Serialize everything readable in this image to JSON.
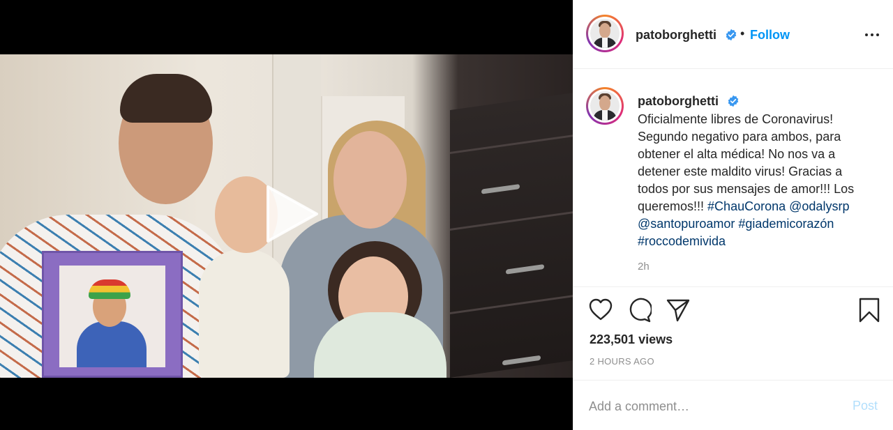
{
  "post": {
    "username": "patoborghetti",
    "verified": true,
    "header_separator": "•",
    "follow_label": "Follow",
    "caption": {
      "line1": "Oficialmente libres de Coronavirus!",
      "line2": "Segundo negativo para ambos, para",
      "line3": "obtener el alta médica! No nos va a",
      "line4": "detener este maldito virus! Gracias a",
      "line5": "todos por sus mensajes de amor!!! Los",
      "line6_text": "queremos!!! ",
      "tags": [
        "#ChauCorona",
        "@odalysrp",
        "@santopuroamor",
        "#giademicorazón",
        "#roccodemivida"
      ]
    },
    "caption_time": "2h",
    "views": "223,501 views",
    "time_ago": "2 HOURS AGO",
    "comment_placeholder": "Add a comment…",
    "post_label": "Post"
  },
  "icons": {
    "more": "more-options-icon",
    "verified": "verified-badge-icon",
    "like": "heart-icon",
    "comment": "comment-bubble-icon",
    "share": "paper-plane-icon",
    "save": "bookmark-icon",
    "play": "play-icon"
  },
  "colors": {
    "accent": "#0095f6",
    "tag": "#00376b",
    "muted": "#8e8e8e",
    "post_disabled": "#b2dffc"
  }
}
